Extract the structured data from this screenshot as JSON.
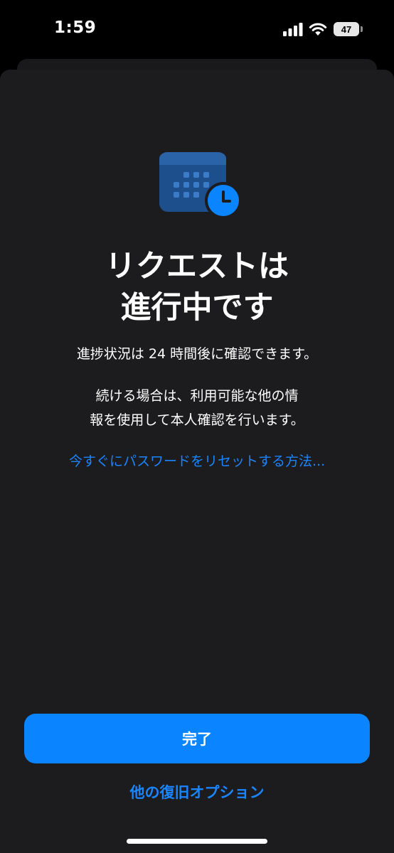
{
  "status_bar": {
    "time": "1:59",
    "battery": "47"
  },
  "main": {
    "icon": "calendar-clock-icon",
    "title_line1": "リクエストは",
    "title_line2": "進行中です",
    "desc1": "進捗状況は 24 時間後に確認できます。",
    "desc2_line1": "続ける場合は、利用可能な他の情",
    "desc2_line2": "報を使用して本人確認を行います。",
    "reset_link": "今すぐにパスワードをリセットする方法..."
  },
  "actions": {
    "done_label": "完了",
    "other_options_label": "他の復旧オプション"
  },
  "colors": {
    "accent": "#0a84ff",
    "link": "#1a85ff",
    "sheet_background": "#1c1c1e",
    "icon_dark_blue": "#1d4f8c"
  }
}
